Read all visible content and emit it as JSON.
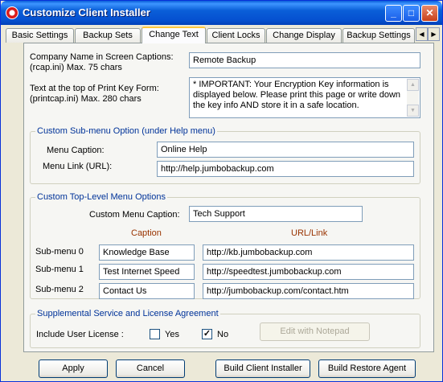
{
  "window": {
    "title": "Customize Client Installer"
  },
  "tabs": [
    {
      "label": "Basic Settings"
    },
    {
      "label": "Backup Sets"
    },
    {
      "label": "Change Text",
      "active": true
    },
    {
      "label": "Client Locks"
    },
    {
      "label": "Change Display"
    },
    {
      "label": "Backup Settings"
    }
  ],
  "captions": {
    "company_label_line1": "Company Name in Screen Captions:",
    "company_label_line2": "(rcap.ini) Max. 75 chars",
    "company_value": "Remote Backup",
    "print_label_line1": "Text at the top of Print Key Form:",
    "print_label_line2": "(printcap.ini) Max. 280 chars",
    "print_value": "* IMPORTANT: Your Encryption Key information is displayed below.  Please print this page or write down the key info AND store it in a safe location."
  },
  "submenu_group": {
    "title": "Custom Sub-menu Option (under Help menu)",
    "caption_label": "Menu Caption:",
    "caption_value": "Online Help",
    "link_label": "Menu Link (URL):",
    "link_value": "http://help.jumbobackup.com"
  },
  "toplevel_group": {
    "title": "Custom Top-Level Menu Options",
    "caption_label": "Custom Menu Caption:",
    "caption_value": "Tech Support",
    "col_caption": "Caption",
    "col_url": "URL/Link",
    "rows": [
      {
        "label": "Sub-menu 0",
        "caption": "Knowledge Base",
        "url": "http://kb.jumbobackup.com"
      },
      {
        "label": "Sub-menu 1",
        "caption": "Test Internet Speed",
        "url": "http://speedtest.jumbobackup.com"
      },
      {
        "label": "Sub-menu 2",
        "caption": "Contact Us",
        "url": "http://jumbobackup.com/contact.htm"
      }
    ]
  },
  "license_group": {
    "title": "Supplemental Service and License Agreement",
    "include_label": "Include User License :",
    "yes_label": "Yes",
    "yes_checked": false,
    "no_label": "No",
    "no_checked": true,
    "edit_button": "Edit with Notepad"
  },
  "buttons": {
    "apply": "Apply",
    "cancel": "Cancel",
    "build_client": "Build Client Installer",
    "build_restore": "Build Restore Agent"
  },
  "colors": {
    "titlebar": "#0a5fd8",
    "group_title": "#003399",
    "column_header": "#993300"
  }
}
